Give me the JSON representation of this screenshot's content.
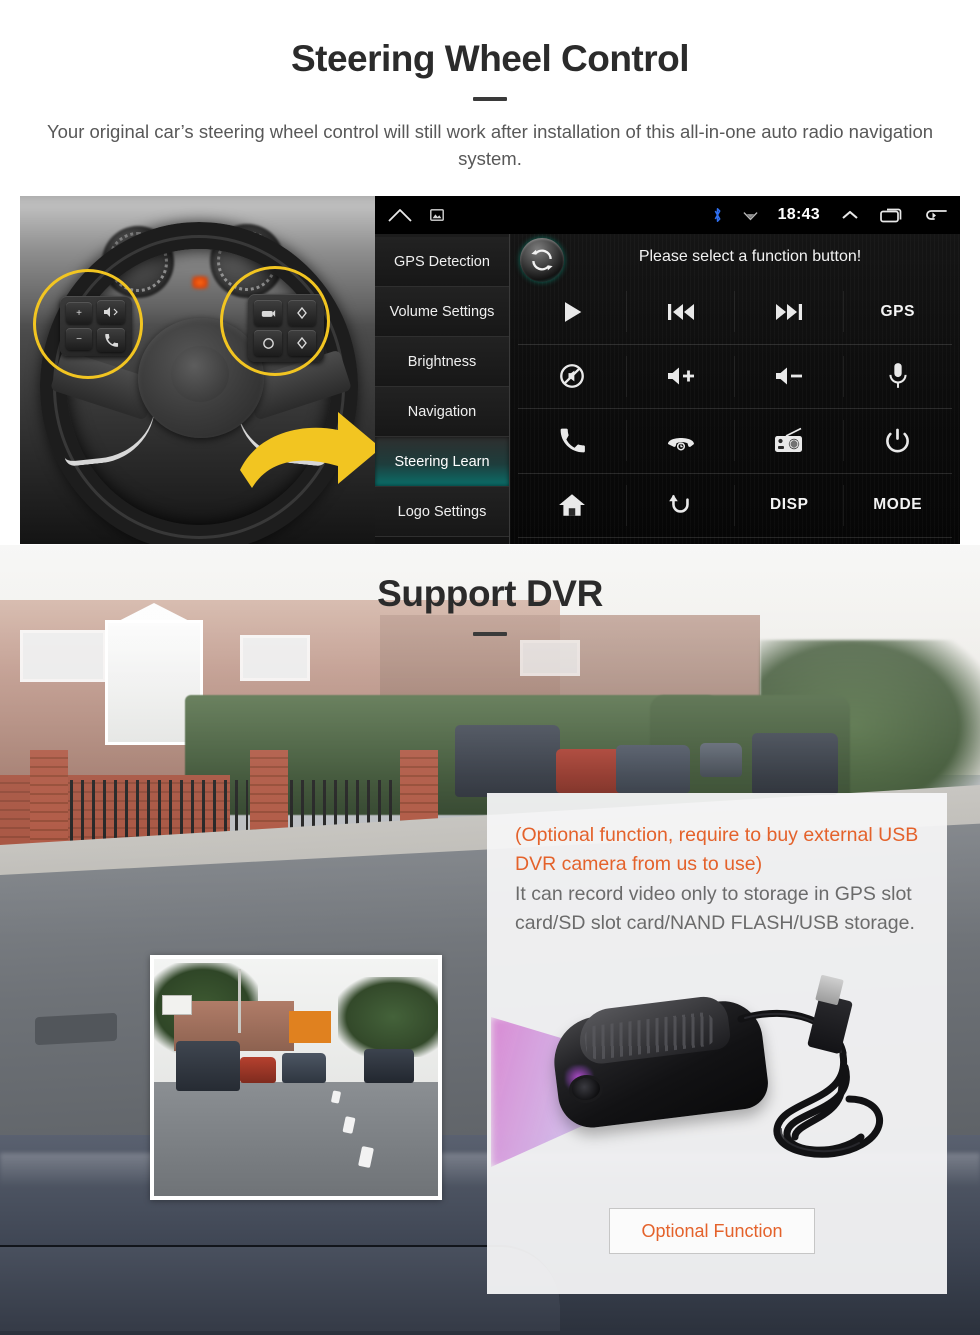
{
  "steering_section": {
    "title": "Steering Wheel Control",
    "subtitle": "Your original car’s steering wheel control will still work after installation of this all-in-one auto radio navigation system.",
    "head_unit": {
      "status_bar": {
        "home_icon": "home-outline-icon",
        "screenshot_icon": "screenshot-icon",
        "bluetooth_icon": "bluetooth-icon",
        "wifi_icon": "wifi-icon",
        "time": "18:43",
        "expand_icon": "chevron-up-icon",
        "recents_icon": "recents-icon",
        "back_icon": "back-arrow-icon",
        "bluetooth_color": "#2f6ff0"
      },
      "menu_items": [
        {
          "label": "GPS Detection",
          "active": false
        },
        {
          "label": "Volume Settings",
          "active": false
        },
        {
          "label": "Brightness",
          "active": false
        },
        {
          "label": "Navigation",
          "active": false
        },
        {
          "label": "Steering Learn",
          "active": true
        },
        {
          "label": "Logo Settings",
          "active": false
        }
      ],
      "prompt": "Please select a function button!",
      "sync_icon": "sync-refresh-icon",
      "accent_color": "#0a6f6a",
      "function_buttons": [
        {
          "icon": "play-icon",
          "label": ""
        },
        {
          "icon": "previous-track-icon",
          "label": ""
        },
        {
          "icon": "next-track-icon",
          "label": ""
        },
        {
          "icon": "gps-label",
          "label": "GPS"
        },
        {
          "icon": "mute-icon",
          "label": ""
        },
        {
          "icon": "volume-up-icon",
          "label": ""
        },
        {
          "icon": "volume-down-icon",
          "label": ""
        },
        {
          "icon": "microphone-icon",
          "label": ""
        },
        {
          "icon": "phone-answer-icon",
          "label": ""
        },
        {
          "icon": "phone-hangup-icon",
          "label": ""
        },
        {
          "icon": "radio-icon",
          "label": ""
        },
        {
          "icon": "power-icon",
          "label": ""
        },
        {
          "icon": "home-icon",
          "label": ""
        },
        {
          "icon": "return-back-icon",
          "label": ""
        },
        {
          "icon": "disp-label",
          "label": "DISP"
        },
        {
          "icon": "mode-label",
          "label": "MODE"
        }
      ]
    },
    "photo": {
      "highlight_color": "#f2c521",
      "arrow_color": "#f2c521",
      "left_pad_keys": [
        "+",
        "−",
        "mode-key",
        "phone-key"
      ],
      "right_pad_keys": [
        "source-key",
        "up-key",
        "circle-key",
        "down-key"
      ]
    }
  },
  "dvr_section": {
    "title": "Support DVR",
    "panel": {
      "note_orange": "(Optional function, require to buy external USB DVR camera from us to use)",
      "note_gray": "It can record video only to storage in GPS slot card/SD slot card/NAND FLASH/USB storage.",
      "button_label": "Optional Function",
      "button_color": "#e4622b",
      "device_icon": "usb-dvr-camera"
    }
  }
}
